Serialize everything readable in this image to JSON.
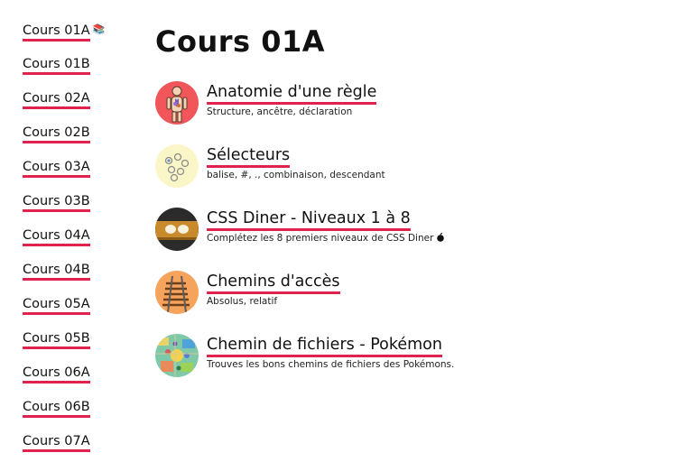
{
  "sidebar": {
    "items": [
      {
        "label": "Cours 01A",
        "marker": "current-page-icon"
      },
      {
        "label": "Cours 01B"
      },
      {
        "label": "Cours 02A"
      },
      {
        "label": "Cours 02B"
      },
      {
        "label": "Cours 03A"
      },
      {
        "label": "Cours 03B"
      },
      {
        "label": "Cours 04A"
      },
      {
        "label": "Cours 04B"
      },
      {
        "label": "Cours 05A"
      },
      {
        "label": "Cours 05B"
      },
      {
        "label": "Cours 06A"
      },
      {
        "label": "Cours 06B"
      },
      {
        "label": "Cours 07A"
      }
    ]
  },
  "main": {
    "title": "Cours 01A",
    "lessons": [
      {
        "title": "Anatomie d'une règle",
        "description": "Structure, ancêtre, déclaration",
        "icon": "anatomy-icon"
      },
      {
        "title": "Sélecteurs",
        "description": "balise, #, ., combinaison, descendant",
        "icon": "selectors-icon"
      },
      {
        "title": "CSS Diner - Niveaux 1 à 8",
        "description": "Complétez les 8 premiers niveaux de CSS Diner",
        "icon": "css-diner-icon",
        "trailing_icon": "apple-icon"
      },
      {
        "title": "Chemins d'accès",
        "description": "Absolus, relatif",
        "icon": "railway-track-icon"
      },
      {
        "title": "Chemin de fichiers - Pokémon",
        "description": "Trouves les bons chemins de fichiers des Pokémons.",
        "icon": "pokemon-map-icon"
      }
    ]
  },
  "colors": {
    "underline": "#e0224f",
    "text": "#111111",
    "background": "#ffffff"
  }
}
